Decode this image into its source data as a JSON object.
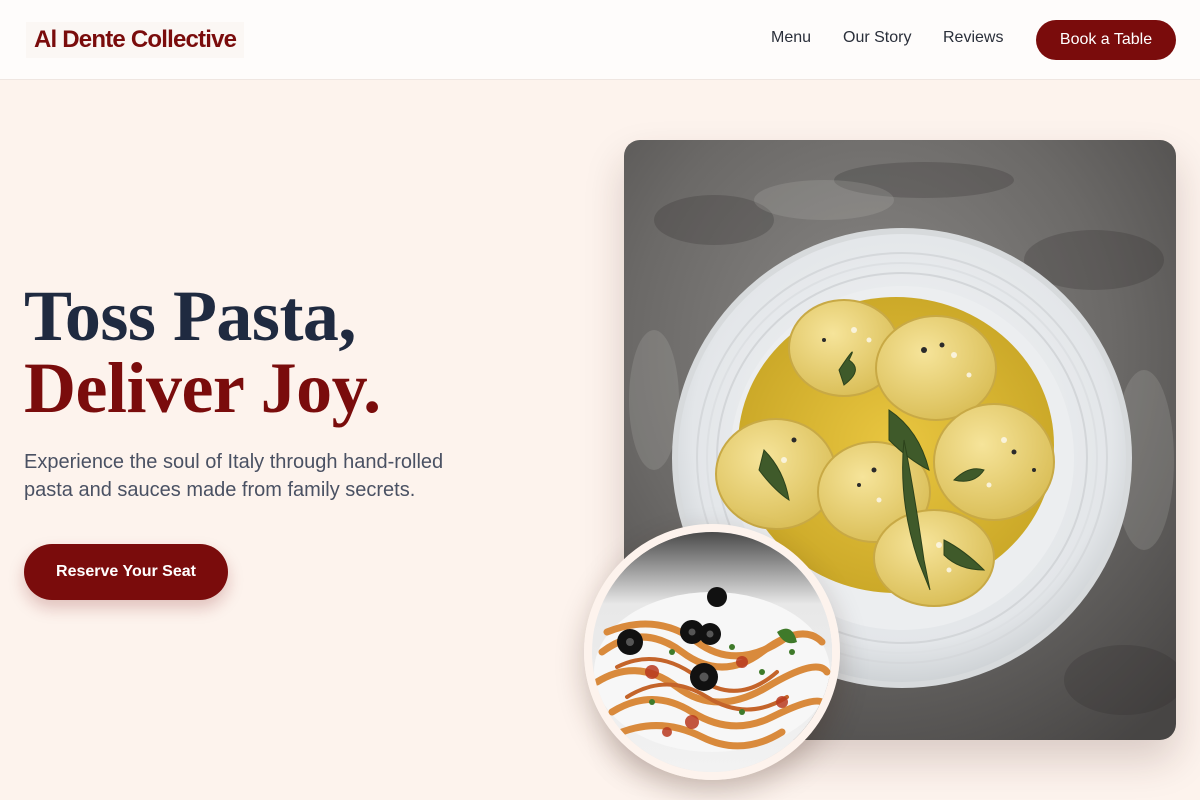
{
  "header": {
    "logo": "Al Dente Collective",
    "nav": [
      {
        "label": "Menu"
      },
      {
        "label": "Our Story"
      },
      {
        "label": "Reviews"
      }
    ],
    "cta_label": "Book a Table"
  },
  "hero": {
    "title_line1": "Toss Pasta,",
    "title_line2": "Deliver Joy.",
    "subtitle": "Experience the soul of Italy through hand-rolled pasta and sauces made from family secrets.",
    "cta_label": "Reserve Your Seat"
  },
  "images": {
    "main": "ravioli-dish-photo",
    "secondary": "tagliatelle-dish-photo"
  },
  "colors": {
    "brand": "#7a0c0c",
    "heading": "#1f2a40",
    "background": "#fdf3ed"
  }
}
